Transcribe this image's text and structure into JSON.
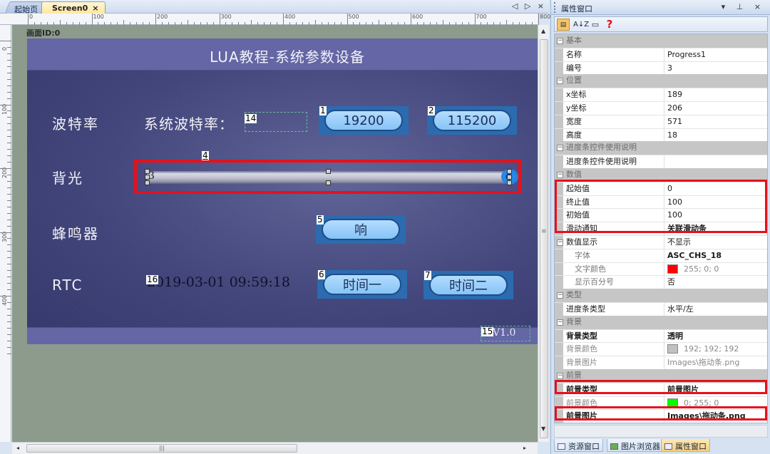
{
  "editor": {
    "tabs": [
      {
        "label": "起始页",
        "active": false
      },
      {
        "label": "Screen0",
        "active": true,
        "close": "×"
      }
    ],
    "tab_nav": "◁ ▷ ×",
    "hruler_labels": [
      "0",
      "100",
      "200",
      "300",
      "400",
      "500",
      "600",
      "700",
      "800"
    ],
    "vruler_labels": [
      "0",
      "100",
      "200",
      "300",
      "400"
    ],
    "screen_id": "画面ID:0"
  },
  "screen": {
    "title": "LUA教程-系统参数设备",
    "rows": {
      "baud_label": "波特率",
      "backlight_label": "背光",
      "buzzer_label": "蜂鸣器",
      "rtc_label": "RTC"
    },
    "baud_static": "系统波特率：",
    "rtc_value": "2019-03-01 09:59:18",
    "version": "V1.0",
    "buttons": [
      {
        "id": "1",
        "label": "19200"
      },
      {
        "id": "2",
        "label": "115200"
      },
      {
        "id": "5",
        "label": "响"
      },
      {
        "id": "6",
        "label": "时间一"
      },
      {
        "id": "7",
        "label": "时间二"
      }
    ],
    "tags": {
      "baud_text": "14",
      "backlight_text": "4",
      "progress": "3",
      "rtc": "16",
      "version": "15"
    },
    "progress": {
      "min": 0,
      "max": 100,
      "value": 100
    }
  },
  "properties": {
    "title": "属性窗口",
    "title_controls": "▾ ⊥ ×",
    "toolbar": {
      "categorized": "categorized-icon",
      "alphabetical": "A↓Z",
      "pages": "property-pages-icon",
      "help": "?"
    },
    "categories": [
      {
        "name": "基本",
        "props": [
          {
            "name": "名称",
            "value": "Progress1"
          },
          {
            "name": "编号",
            "value": "3"
          }
        ]
      },
      {
        "name": "位置",
        "props": [
          {
            "name": "x坐标",
            "value": "189"
          },
          {
            "name": "y坐标",
            "value": "206"
          },
          {
            "name": "宽度",
            "value": "571"
          },
          {
            "name": "高度",
            "value": "18"
          }
        ]
      },
      {
        "name": "进度条控件使用说明",
        "props": [
          {
            "name": "进度条控件使用说明",
            "value": ""
          }
        ]
      },
      {
        "name": "数值",
        "props": [
          {
            "name": "起始值",
            "value": "0"
          },
          {
            "name": "终止值",
            "value": "100"
          },
          {
            "name": "初始值",
            "value": "100"
          },
          {
            "name": "滑动通知",
            "value": "关联滑动条"
          }
        ]
      },
      {
        "name": "数值显示",
        "value": "不显示",
        "props": [
          {
            "name": "字体",
            "value": "ASC_CHS_18"
          },
          {
            "name": "文字颜色",
            "value": "255; 0; 0",
            "swatch": "#ff0000"
          },
          {
            "name": "显示百分号",
            "value": "否"
          }
        ]
      },
      {
        "name": "类型",
        "props": [
          {
            "name": "进度条类型",
            "value": "水平/左"
          }
        ]
      },
      {
        "name": "背景",
        "props": [
          {
            "name": "背景类型",
            "value": "透明"
          },
          {
            "name": "背景颜色",
            "value": "192; 192; 192",
            "swatch": "#c0c0c0"
          },
          {
            "name": "背景图片",
            "value": "Images\\拖动条.png"
          }
        ]
      },
      {
        "name": "前景",
        "props": [
          {
            "name": "前景类型",
            "value": "前景图片"
          },
          {
            "name": "前景颜色",
            "value": "0; 255; 0",
            "swatch": "#00ff00"
          },
          {
            "name": "前景图片",
            "value": "Images\\拖动条.png"
          }
        ]
      }
    ],
    "bottom_tabs": [
      {
        "label": "资源窗口",
        "active": false
      },
      {
        "label": "图片浏览器",
        "active": false
      },
      {
        "label": "属性窗口",
        "active": true
      }
    ]
  },
  "colors": {
    "highlight": "#e8101a",
    "screen_header": "#6466a5",
    "button_fill": "#9fd0fb",
    "canvas": "#8c9b8b"
  }
}
